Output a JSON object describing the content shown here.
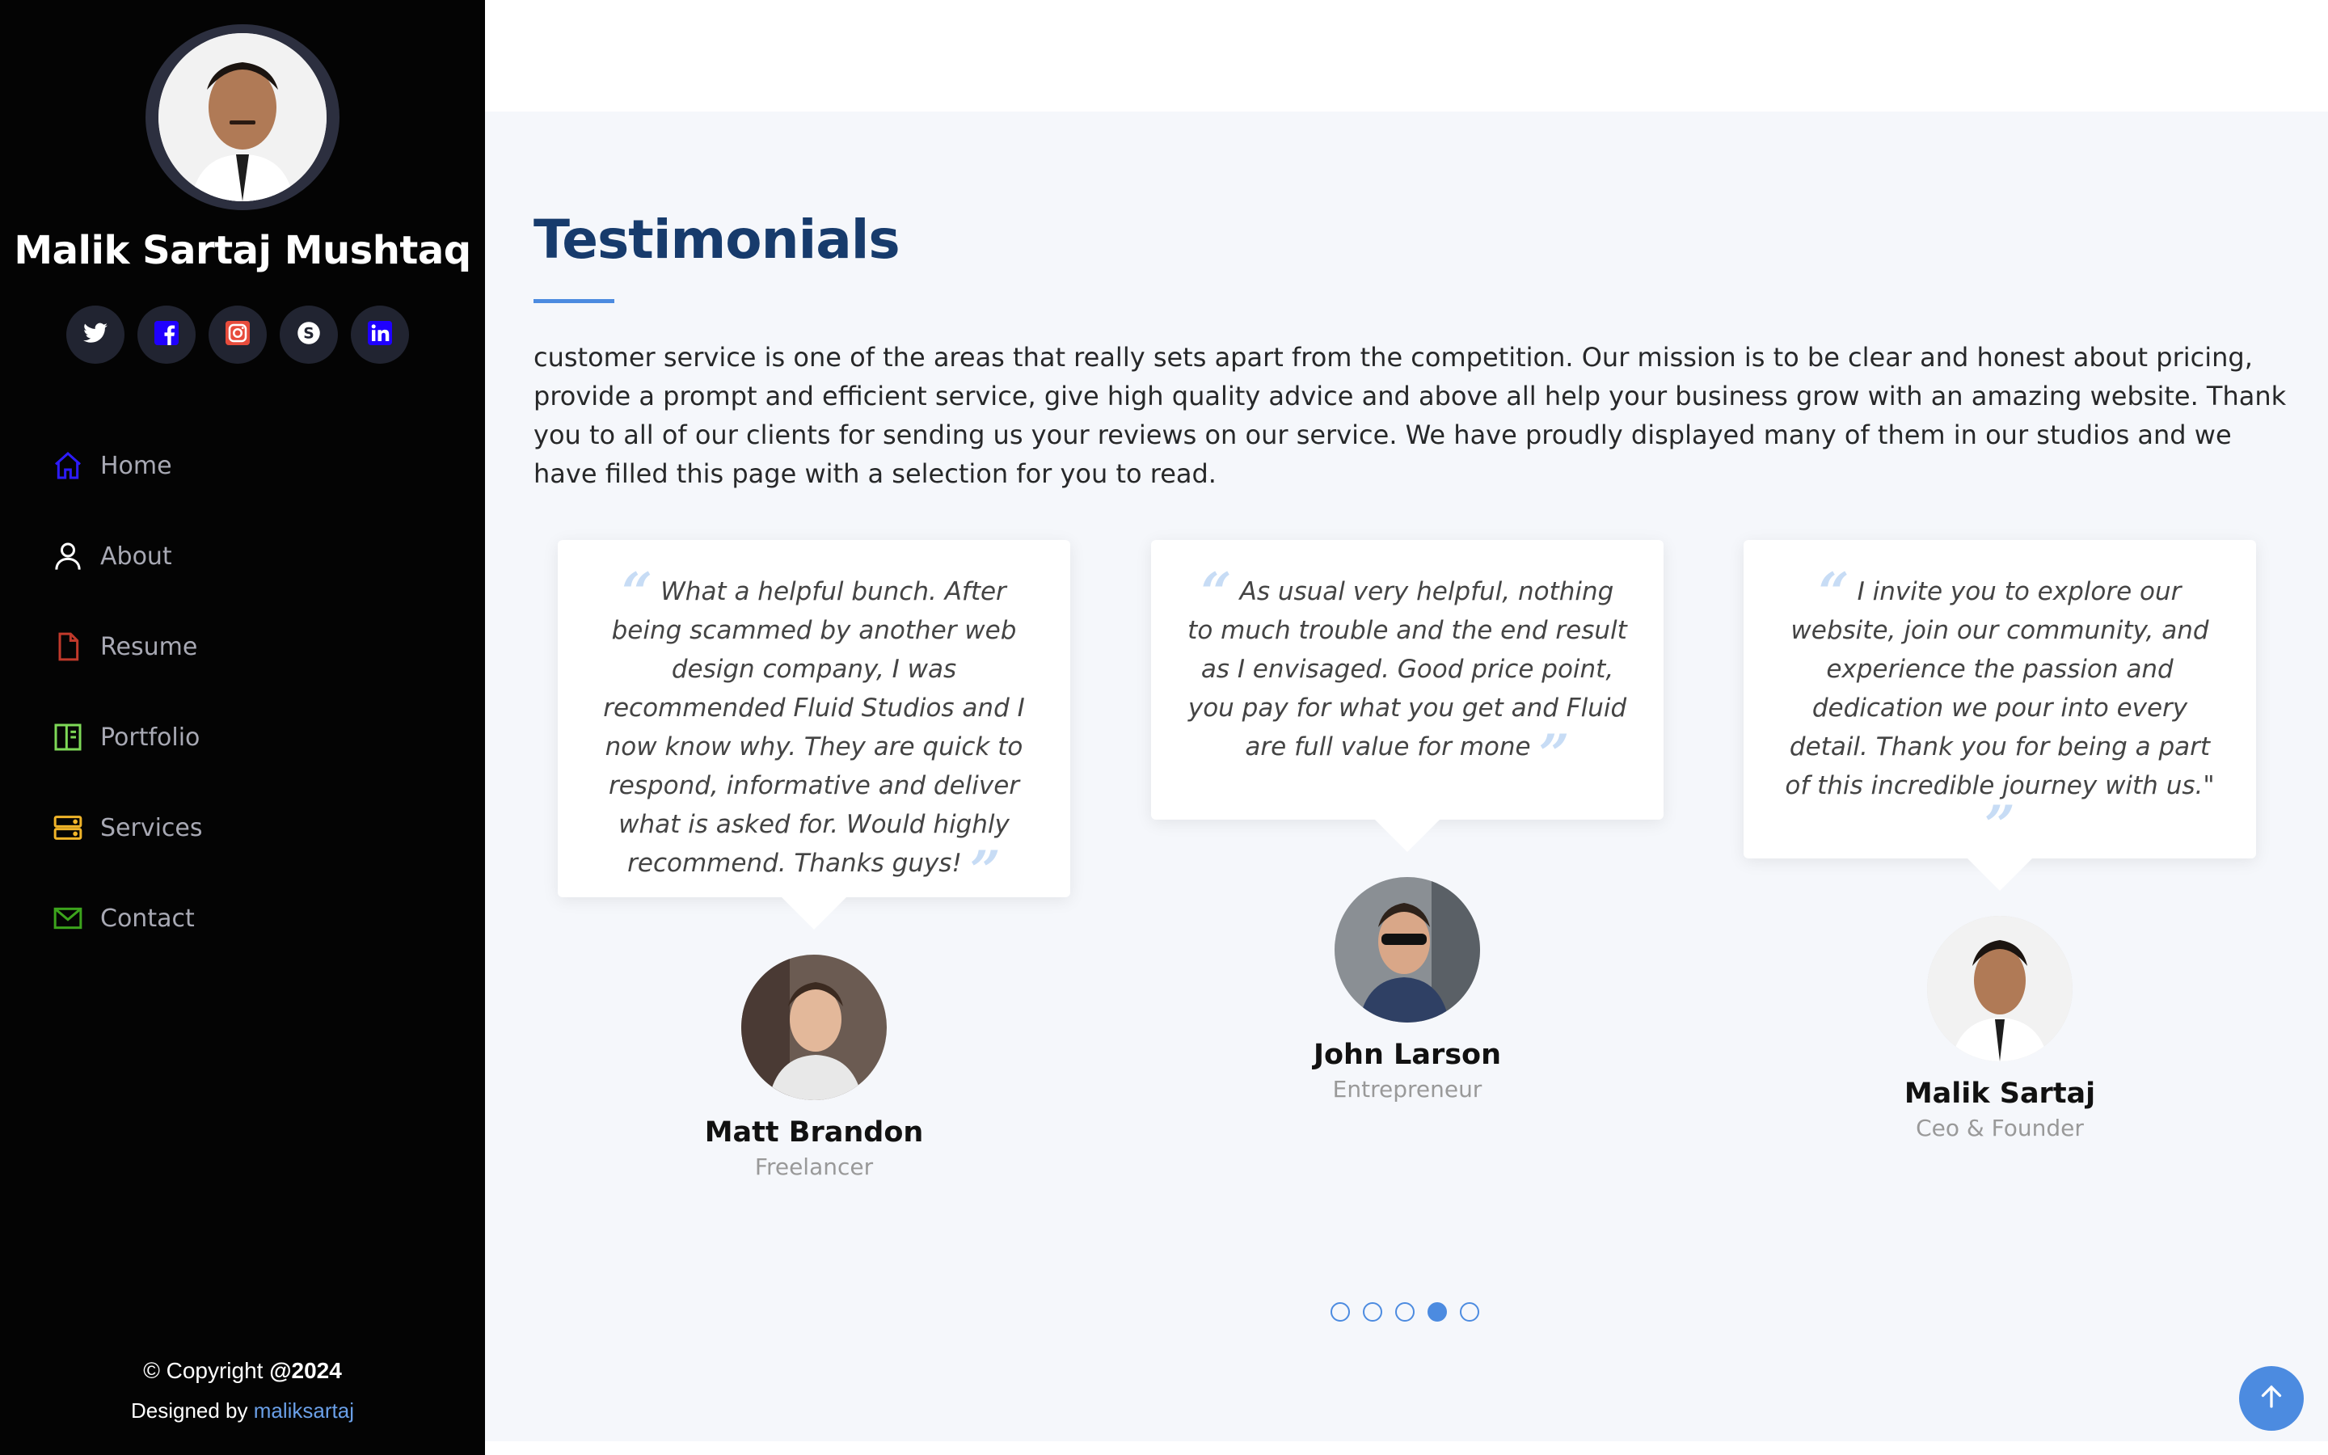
{
  "sidebar": {
    "name": "Malik Sartaj Mushtaq",
    "socials": [
      {
        "icon": "twitter-icon",
        "color": "#ffffff"
      },
      {
        "icon": "facebook-icon",
        "color": "#1f00ff"
      },
      {
        "icon": "instagram-icon",
        "color": "#e4405f"
      },
      {
        "icon": "skype-icon",
        "color": "#ffffff"
      },
      {
        "icon": "linkedin-icon",
        "color": "#1f00ff"
      }
    ],
    "nav": [
      {
        "label": "Home",
        "icon": "home-icon",
        "color": "#2d1bff"
      },
      {
        "label": "About",
        "icon": "person-icon",
        "color": "#ffffff"
      },
      {
        "label": "Resume",
        "icon": "file-icon",
        "color": "#c0392b"
      },
      {
        "label": "Portfolio",
        "icon": "book-icon",
        "color": "#7ed957"
      },
      {
        "label": "Services",
        "icon": "server-icon",
        "color": "#f0b429"
      },
      {
        "label": "Contact",
        "icon": "envelope-icon",
        "color": "#3ca41c"
      }
    ],
    "copyright_prefix": "© Copyright ",
    "copyright_year": "@2024",
    "designed_by_prefix": "Designed by ",
    "designed_by_link": "maliksartaj"
  },
  "section": {
    "title": "Testimonials",
    "description": "customer service is one of the areas that really sets apart from the competition. Our mission is to be clear and honest about pricing, provide a prompt and efficient service, give high quality advice and above all help your business grow with an amazing website. Thank you to all of our clients for sending us your reviews on our service. We have proudly displayed many of them in our studios and we have filled this page with a selection for you to read."
  },
  "testimonials": [
    {
      "quote": "What a helpful bunch. After being scammed by another web design company, I was recommended Fluid Studios and I now know why. They are quick to respond, informative and deliver what is asked for. Would highly recommend. Thanks guys!",
      "name": "Matt Brandon",
      "role": "Freelancer"
    },
    {
      "quote": "As usual very helpful, nothing to much trouble and the end result as I envisaged. Good price point, you pay for what you get and Fluid are full value for mone",
      "name": "John Larson",
      "role": "Entrepreneur"
    },
    {
      "quote": "I invite you to explore our website, join our community, and experience the passion and dedication we pour into every detail. Thank you for being a part of this incredible journey with us.\"",
      "name": "Malik Sartaj",
      "role": "Ceo & Founder"
    }
  ],
  "carousel": {
    "pages": 5,
    "active": 4
  },
  "colors": {
    "accent": "#4c8be0",
    "title": "#173b6c",
    "sidebar_bg": "#040404"
  }
}
